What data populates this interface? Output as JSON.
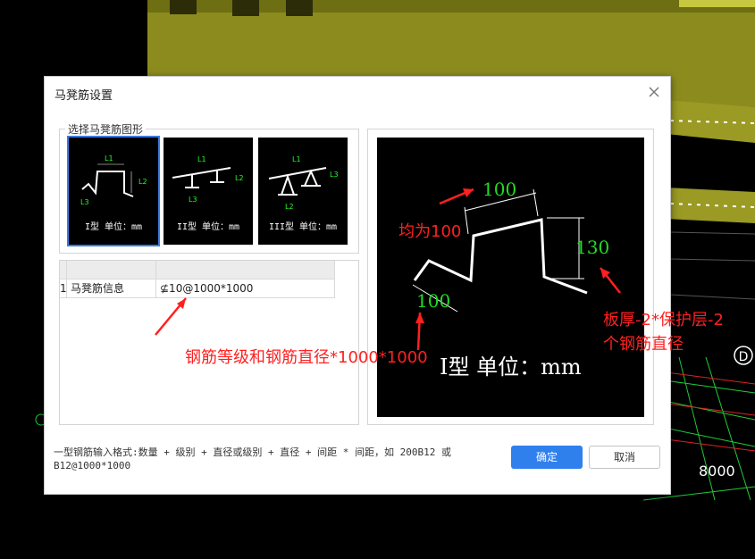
{
  "dialog": {
    "title": "马凳筋设置",
    "group_label": "选择马凳筋图形",
    "shapes": [
      {
        "caption": "I型 单位：mm"
      },
      {
        "caption": "II型 单位：mm"
      },
      {
        "caption": "III型 单位：mm"
      }
    ],
    "table": {
      "rows": [
        {
          "index": "1",
          "name": "马凳筋信息",
          "value": "⊈10@1000*1000"
        }
      ]
    },
    "preview": {
      "dim_top": "100",
      "dim_right": "130",
      "dim_left": "100",
      "caption": "I型 单位：mm"
    },
    "hint": "一型钢筋输入格式:数量 + 级别 + 直径或级别 + 直径 + 间距 * 间距，如 200B12 或 B12@1000*1000",
    "ok_label": "确定",
    "cancel_label": "取消"
  },
  "annotations": {
    "all_100": "均为100",
    "rebar_format": "钢筋等级和钢筋直径*1000*1000",
    "formula_line1": "板厚-2*保护层-2",
    "formula_line2": "个钢筋直径"
  },
  "background": {
    "label_d": "D",
    "dim_8000": "8000"
  },
  "colors": {
    "accent": "#2f80ed",
    "annotation": "#ff2020",
    "dim_green": "#22dd22",
    "model_yellow": "#8c8c1e"
  }
}
